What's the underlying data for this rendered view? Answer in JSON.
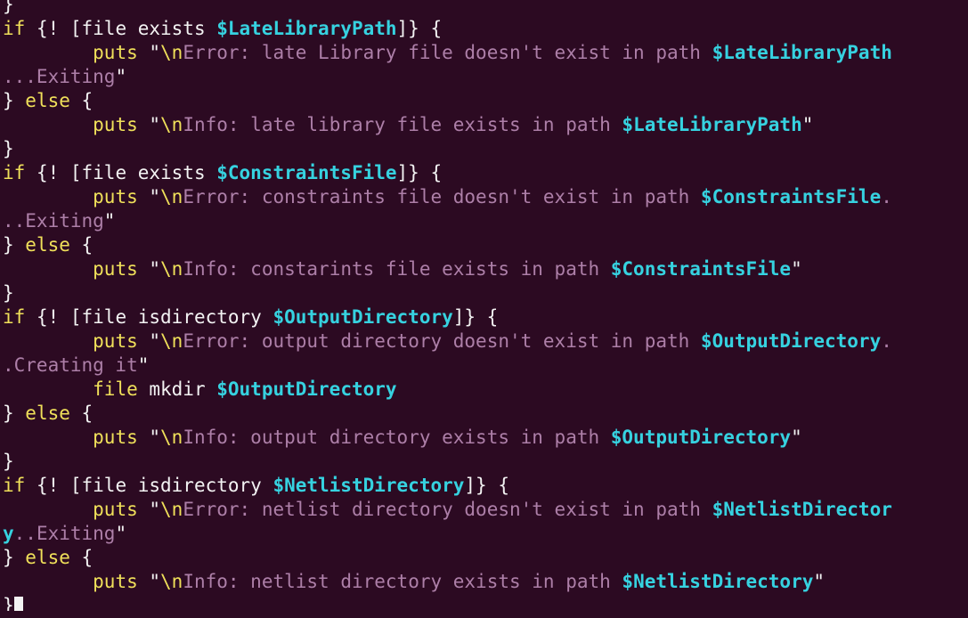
{
  "colors": {
    "background": "#2c0a22",
    "keyword": "#f0e05a",
    "variable": "#36d2e0",
    "string": "#ad7fa8",
    "plain": "#f3f3f3"
  },
  "lines": [
    [
      [
        "plain",
        "}"
      ]
    ],
    [
      [
        "kw",
        "if"
      ],
      [
        "plain",
        " {! [file exists "
      ],
      [
        "var",
        "$LateLibraryPath"
      ],
      [
        "plain",
        "]} {"
      ]
    ],
    [
      [
        "plain",
        "        "
      ],
      [
        "kw",
        "puts"
      ],
      [
        "plain",
        " \""
      ],
      [
        "esc",
        "\\n"
      ],
      [
        "str",
        "Error: late Library file doesn't exist in path "
      ],
      [
        "var",
        "$LateLibraryPath"
      ]
    ],
    [
      [
        "str",
        "...Exiting"
      ],
      [
        "plain",
        "\""
      ]
    ],
    [
      [
        "plain",
        "} "
      ],
      [
        "kw",
        "else"
      ],
      [
        "plain",
        " {"
      ]
    ],
    [
      [
        "plain",
        "        "
      ],
      [
        "kw",
        "puts"
      ],
      [
        "plain",
        " \""
      ],
      [
        "esc",
        "\\n"
      ],
      [
        "str",
        "Info: late library file exists in path "
      ],
      [
        "var",
        "$LateLibraryPath"
      ],
      [
        "plain",
        "\""
      ]
    ],
    [
      [
        "plain",
        "}"
      ]
    ],
    [
      [
        "kw",
        "if"
      ],
      [
        "plain",
        " {! [file exists "
      ],
      [
        "var",
        "$ConstraintsFile"
      ],
      [
        "plain",
        "]} {"
      ]
    ],
    [
      [
        "plain",
        "        "
      ],
      [
        "kw",
        "puts"
      ],
      [
        "plain",
        " \""
      ],
      [
        "esc",
        "\\n"
      ],
      [
        "str",
        "Error: constraints file doesn't exist in path "
      ],
      [
        "var",
        "$ConstraintsFile"
      ],
      [
        "str",
        "."
      ]
    ],
    [
      [
        "str",
        "..Exiting"
      ],
      [
        "plain",
        "\""
      ]
    ],
    [
      [
        "plain",
        "} "
      ],
      [
        "kw",
        "else"
      ],
      [
        "plain",
        " {"
      ]
    ],
    [
      [
        "plain",
        "        "
      ],
      [
        "kw",
        "puts"
      ],
      [
        "plain",
        " \""
      ],
      [
        "esc",
        "\\n"
      ],
      [
        "str",
        "Info: constarints file exists in path "
      ],
      [
        "var",
        "$ConstraintsFile"
      ],
      [
        "plain",
        "\""
      ]
    ],
    [
      [
        "plain",
        "}"
      ]
    ],
    [
      [
        "kw",
        "if"
      ],
      [
        "plain",
        " {! [file isdirectory "
      ],
      [
        "var",
        "$OutputDirectory"
      ],
      [
        "plain",
        "]} {"
      ]
    ],
    [
      [
        "plain",
        "        "
      ],
      [
        "kw",
        "puts"
      ],
      [
        "plain",
        " \""
      ],
      [
        "esc",
        "\\n"
      ],
      [
        "str",
        "Error: output directory doesn't exist in path "
      ],
      [
        "var",
        "$OutputDirectory"
      ],
      [
        "str",
        "."
      ]
    ],
    [
      [
        "str",
        ".Creating it"
      ],
      [
        "plain",
        "\""
      ]
    ],
    [
      [
        "plain",
        "        "
      ],
      [
        "kw",
        "file"
      ],
      [
        "plain",
        " mkdir "
      ],
      [
        "var",
        "$OutputDirectory"
      ]
    ],
    [
      [
        "plain",
        "} "
      ],
      [
        "kw",
        "else"
      ],
      [
        "plain",
        " {"
      ]
    ],
    [
      [
        "plain",
        "        "
      ],
      [
        "kw",
        "puts"
      ],
      [
        "plain",
        " \""
      ],
      [
        "esc",
        "\\n"
      ],
      [
        "str",
        "Info: output directory exists in path "
      ],
      [
        "var",
        "$OutputDirectory"
      ],
      [
        "plain",
        "\""
      ]
    ],
    [
      [
        "plain",
        "}"
      ]
    ],
    [
      [
        "kw",
        "if"
      ],
      [
        "plain",
        " {! [file isdirectory "
      ],
      [
        "var",
        "$NetlistDirectory"
      ],
      [
        "plain",
        "]} {"
      ]
    ],
    [
      [
        "plain",
        "        "
      ],
      [
        "kw",
        "puts"
      ],
      [
        "plain",
        " \""
      ],
      [
        "esc",
        "\\n"
      ],
      [
        "str",
        "Error: netlist directory doesn't exist in path "
      ],
      [
        "var",
        "$NetlistDirector"
      ]
    ],
    [
      [
        "var",
        "y"
      ],
      [
        "str",
        "..Exiting"
      ],
      [
        "plain",
        "\""
      ]
    ],
    [
      [
        "plain",
        "} "
      ],
      [
        "kw",
        "else"
      ],
      [
        "plain",
        " {"
      ]
    ],
    [
      [
        "plain",
        "        "
      ],
      [
        "kw",
        "puts"
      ],
      [
        "plain",
        " \""
      ],
      [
        "esc",
        "\\n"
      ],
      [
        "str",
        "Info: netlist directory exists in path "
      ],
      [
        "var",
        "$NetlistDirectory"
      ],
      [
        "plain",
        "\""
      ]
    ],
    [
      [
        "plain",
        "}"
      ]
    ]
  ]
}
